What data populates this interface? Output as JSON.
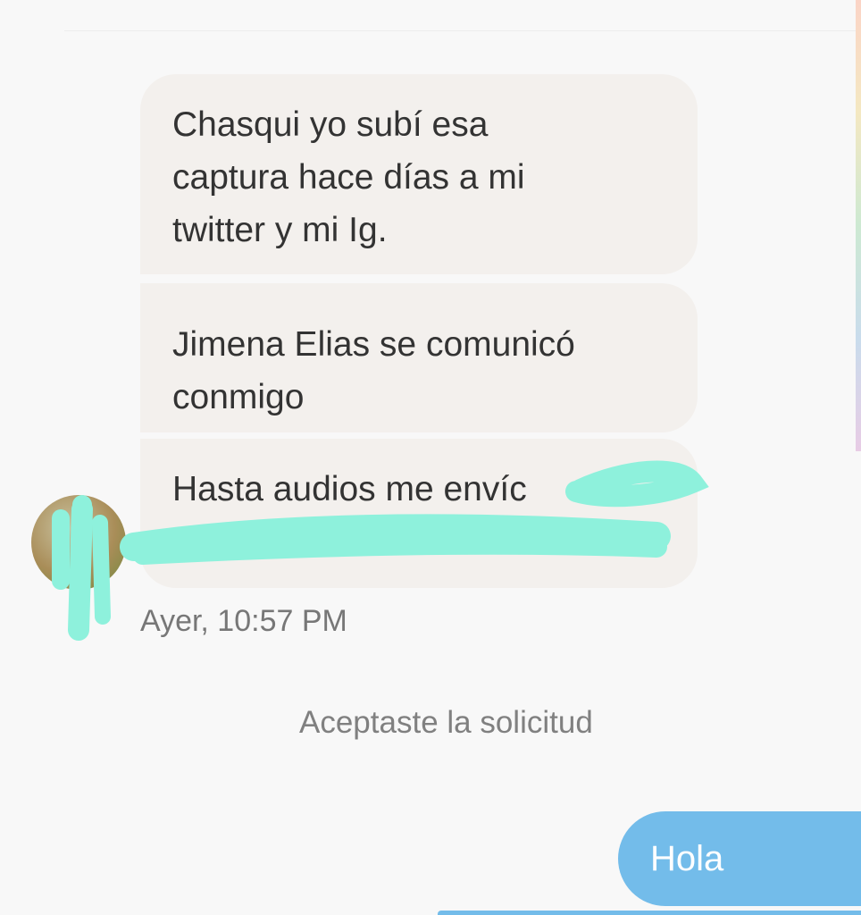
{
  "conversation": {
    "received_messages": [
      {
        "lines": [
          "Chasqui yo subí esa",
          "captura hace días a mi",
          "twitter y mi Ig."
        ]
      },
      {
        "lines": [
          "Jimena Elias se comunicó",
          "conmigo"
        ]
      },
      {
        "lines": [
          "Hasta audios me envíc",
          ""
        ]
      }
    ],
    "timestamp": "Ayer, 10:57 PM",
    "system_note": "Aceptaste la solicitud",
    "sent_message": "Hola"
  },
  "colors": {
    "received_bubble": "#f3f0ed",
    "sent_bubble": "#73bcea",
    "redaction_scribble": "#8ef1dc"
  },
  "icons": {
    "avatar": "contact-avatar"
  }
}
